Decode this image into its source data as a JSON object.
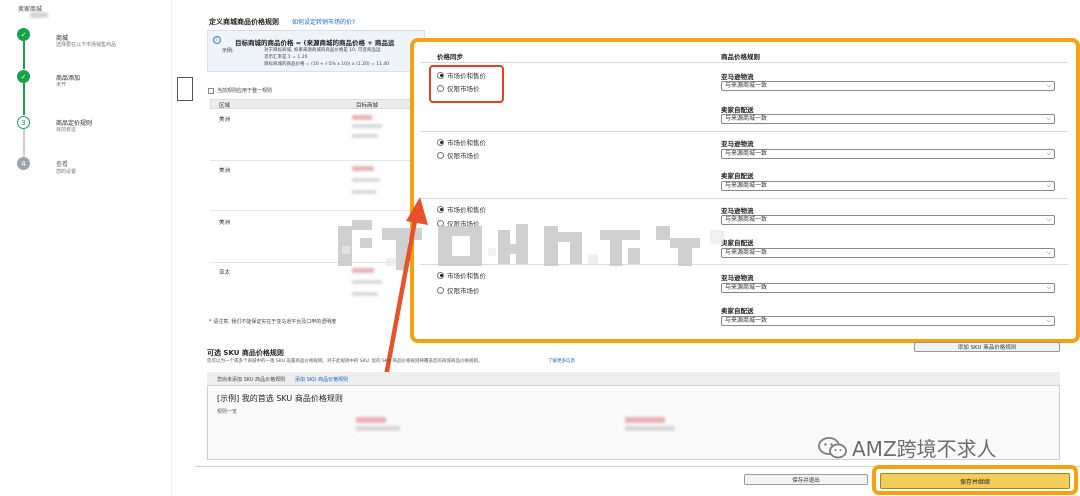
{
  "stepper": {
    "header": "卖家商城",
    "steps": [
      {
        "title": "商城",
        "sub": "选择要在以下市场销售商品",
        "state": "done",
        "glyph": "✓"
      },
      {
        "title": "商品添加",
        "sub": "未开",
        "state": "done",
        "glyph": "✓"
      },
      {
        "title": "商品定价规则",
        "sub": "目前有这",
        "state": "current",
        "glyph": "3"
      },
      {
        "title": "查看",
        "sub": "您的设置",
        "state": "todo",
        "glyph": "4"
      }
    ]
  },
  "rules": {
    "title": "定义商城商品价格规则",
    "help_link": "如何设定转销市场的价?",
    "info_formula": "目标商城的商品价格 = (来源商城的商品价格 + 商品运",
    "info_example_label": "示例:",
    "info_lines": [
      "对于目标商城, 如果来源商城的商品价格是 10, 可变商品运",
      "货币汇率是 1 = 1.20",
      "目标商城的商品价格 = (10 + (-5% x 10)) x (1.20) = 11.40"
    ],
    "checkbox_label": "当前规则应用于整一规则",
    "table_headers": [
      "区域",
      "目标商城"
    ],
    "regions": [
      "美洲",
      "美洲",
      "美洲",
      "亚太"
    ],
    "note": "* 请注意, 我们不能保证实在于亚马逊平台及口申的透明度"
  },
  "sync": {
    "col_price_sync": "价格同步",
    "col_rule": "商品价格规则",
    "opt_market_and_sale": "市场价和售价",
    "opt_market_only": "仅限市场价",
    "amazon_fulfilled": "亚马逊物流",
    "seller_fulfilled": "卖家自配送",
    "select_value": "与来源商城一致",
    "chevron": "⌵",
    "selected": [
      [
        "on",
        "off"
      ],
      [
        "on",
        "off"
      ],
      [
        "on",
        "off"
      ],
      [
        "on",
        "off"
      ]
    ]
  },
  "sku": {
    "title": "可选 SKU 商品价格规则",
    "desc": "您可以为一个或多个商城中的一组 SKU 设置商品价格规则。对于此规则中的 SKU, 您的 SKU 商品价格规则将覆盖您的商城商品价格规则。",
    "learn_more": "了解更多信息",
    "add_button": "添加 SKU 商品价格规则",
    "list_header_text": "您尚未添加 SKU 商品价格规则",
    "list_header_link": "添加 SKU 商品价格规则",
    "example_title": "[示例] 我的首选 SKU 商品价格规则",
    "example_sub": "规则一览"
  },
  "footer": {
    "save_draft": "保存并退出",
    "save_continue": "保存并继续"
  },
  "watermark": {
    "text": "AMZ跨境不求人"
  },
  "colors": {
    "accent_orange": "#f7a10f",
    "highlight_red": "#e0431f",
    "step_green": "#16a34a",
    "primary_button": "#f2cd59",
    "link_blue": "#1a66c6"
  }
}
